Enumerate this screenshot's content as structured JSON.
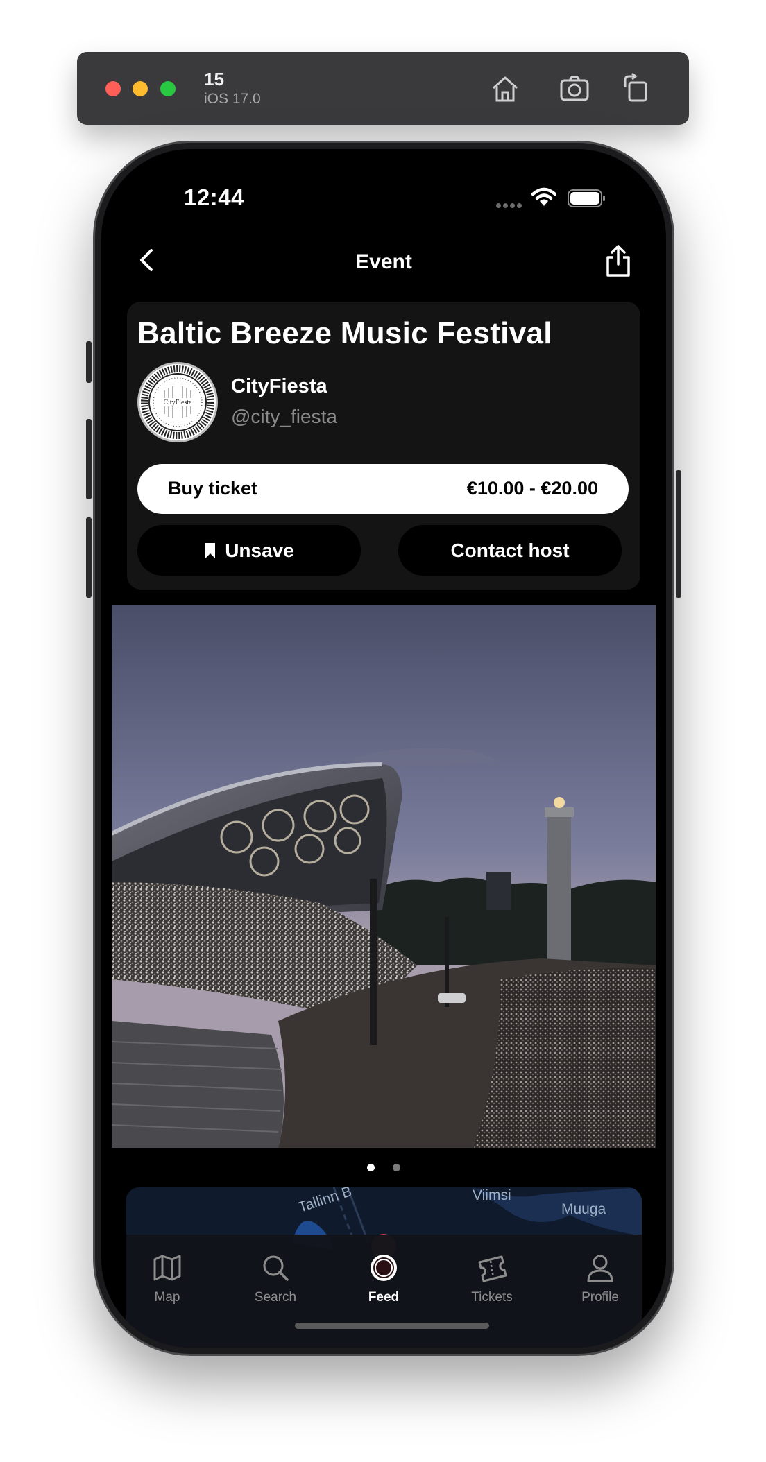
{
  "simulator": {
    "device_name": "15",
    "os_version": "iOS 17.0",
    "controls": [
      "home-icon",
      "screenshot-icon",
      "rotate-icon"
    ]
  },
  "status_bar": {
    "time": "12:44"
  },
  "nav": {
    "title": "Event",
    "back_icon": "chevron-left-icon",
    "share_icon": "share-icon"
  },
  "event": {
    "title": "Baltic Breeze Music Festival",
    "host_name": "CityFiesta",
    "host_handle": "@city_fiesta",
    "host_logo_text": "CityFiesta",
    "buy_label": "Buy ticket",
    "price_range": "€10.00 - €20.00",
    "unsave_label": "Unsave",
    "contact_label": "Contact host",
    "photo_pages": 2,
    "current_photo_page": 1
  },
  "map_preview": {
    "labels": [
      "Tallinn B",
      "Viimsi",
      "Muuga"
    ]
  },
  "tab_bar": {
    "tabs": [
      {
        "label": "Map",
        "icon": "map-icon",
        "active": false
      },
      {
        "label": "Search",
        "icon": "search-icon",
        "active": false
      },
      {
        "label": "Feed",
        "icon": "feed-icon",
        "active": true
      },
      {
        "label": "Tickets",
        "icon": "ticket-icon",
        "active": false
      },
      {
        "label": "Profile",
        "icon": "profile-icon",
        "active": false
      }
    ]
  },
  "colors": {
    "screen_background": "#000000",
    "card_background": "#141414",
    "primary_button": "#ffffff",
    "secondary_button": "#000000",
    "muted_text": "#8a8a8a",
    "active_tab": "#ffffff",
    "inactive_tab": "#8d8d8d"
  }
}
